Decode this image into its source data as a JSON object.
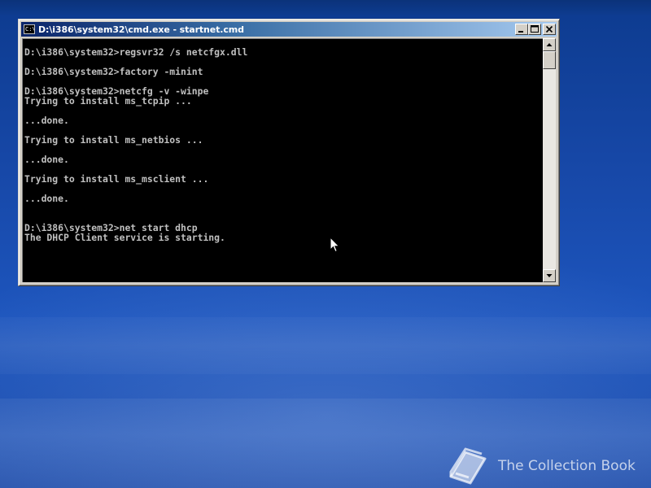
{
  "window": {
    "title": "D:\\i386\\system32\\cmd.exe - startnet.cmd",
    "icon_text": "C:\\"
  },
  "console": {
    "lines": [
      "D:\\i386\\system32>regsvr32 /s netcfgx.dll",
      "",
      "D:\\i386\\system32>factory -minint",
      "",
      "D:\\i386\\system32>netcfg -v -winpe",
      "Trying to install ms_tcpip ...",
      "",
      "...done.",
      "",
      "Trying to install ms_netbios ...",
      "",
      "...done.",
      "",
      "Trying to install ms_msclient ...",
      "",
      "...done.",
      "",
      "",
      "D:\\i386\\system32>net start dhcp",
      "The DHCP Client service is starting."
    ]
  },
  "watermark": {
    "text": "The Collection Book"
  },
  "colors": {
    "console_text": "#c0c0c0",
    "console_bg": "#000000",
    "titlebar_start": "#0a246a",
    "titlebar_end": "#a6caf0"
  },
  "icons": {
    "window": "console-icon",
    "minimize": "minimize-icon",
    "maximize": "maximize-icon",
    "close": "close-icon",
    "scroll_up": "arrow-up-icon",
    "scroll_down": "arrow-down-icon",
    "pointer": "mouse-pointer-icon",
    "logo": "book-icon"
  }
}
